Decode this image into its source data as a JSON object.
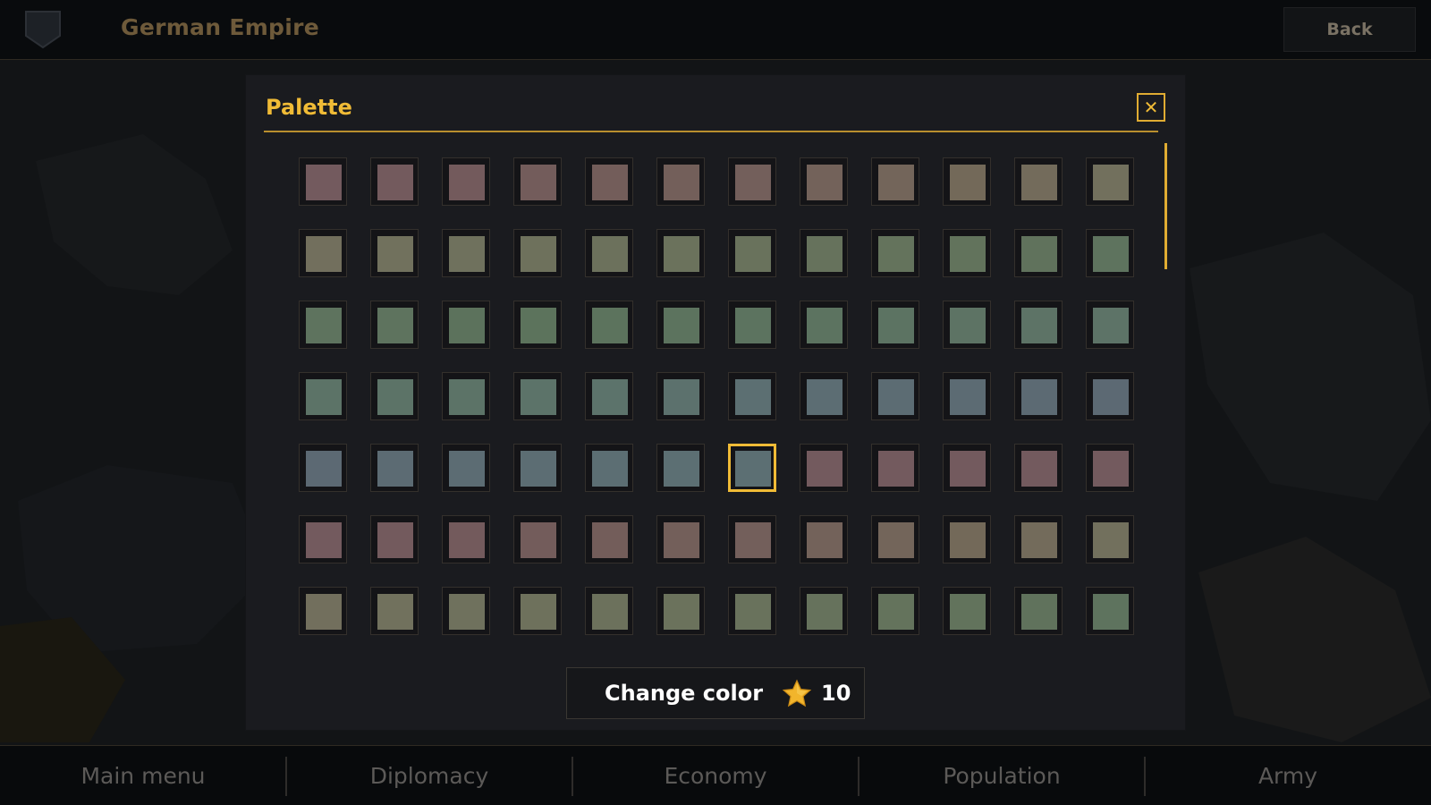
{
  "header": {
    "country_name": "German Empire",
    "back_label": "Back"
  },
  "dialog": {
    "title": "Palette",
    "close_icon": "close-icon",
    "scroll_fraction_shown": 0.22,
    "selected_swatch": {
      "row": 4,
      "col": 6
    },
    "swatch_rows": [
      [
        "#735a5e",
        "#735a5d",
        "#735a5c",
        "#735c5b",
        "#735d5a",
        "#735f5a",
        "#735f5b",
        "#73625a",
        "#73655a",
        "#736959",
        "#736b5b",
        "#72705d"
      ],
      [
        "#726f5d",
        "#71715d",
        "#6f715d",
        "#6e715c",
        "#6c715c",
        "#6b725c",
        "#69725c",
        "#66725c",
        "#64735c",
        "#62735c",
        "#60725c",
        "#5e735e"
      ],
      [
        "#5e735e",
        "#5e735e",
        "#5c725c",
        "#5c735c",
        "#5c735d",
        "#5c735e",
        "#5c735f",
        "#5c7360",
        "#5c7362",
        "#5d7364",
        "#5d7366",
        "#5d7367"
      ],
      [
        "#5c7367",
        "#5c7367",
        "#5c7367",
        "#5c7369",
        "#5c736b",
        "#5c716d",
        "#5c6f72",
        "#5c6d73",
        "#5c6c73",
        "#5c6b73",
        "#5c6a73",
        "#5c6973"
      ],
      [
        "#5c6973",
        "#5c6b73",
        "#5c6c73",
        "#5c6d73",
        "#5c6e73",
        "#5c6f73",
        "#5c6f73",
        "#735a5e",
        "#735a5e",
        "#735a5e",
        "#735a5e",
        "#735a5e"
      ],
      [
        "#735a5e",
        "#735a5d",
        "#735a5c",
        "#735c5b",
        "#735d5a",
        "#735f5a",
        "#735f5b",
        "#73625a",
        "#73655a",
        "#736959",
        "#736b5b",
        "#72705d"
      ],
      [
        "#726f5d",
        "#71715d",
        "#6f715d",
        "#6e715c",
        "#6c715c",
        "#6b725c",
        "#69725c",
        "#66725c",
        "#64735c",
        "#62735c",
        "#60725c",
        "#5e735e"
      ]
    ],
    "change_button": {
      "label": "Change color",
      "cost_icon": "star-icon",
      "cost": "10"
    }
  },
  "bottom_nav": {
    "items": [
      {
        "id": "main-menu",
        "label": "Main menu"
      },
      {
        "id": "diplomacy",
        "label": "Diplomacy"
      },
      {
        "id": "economy",
        "label": "Economy"
      },
      {
        "id": "population",
        "label": "Population"
      },
      {
        "id": "army",
        "label": "Army"
      }
    ]
  },
  "colors": {
    "accent": "#f0bb36",
    "panel": "#1a1b1f",
    "header_text": "#6e5a3a",
    "nav_text": "#5c5a58"
  }
}
